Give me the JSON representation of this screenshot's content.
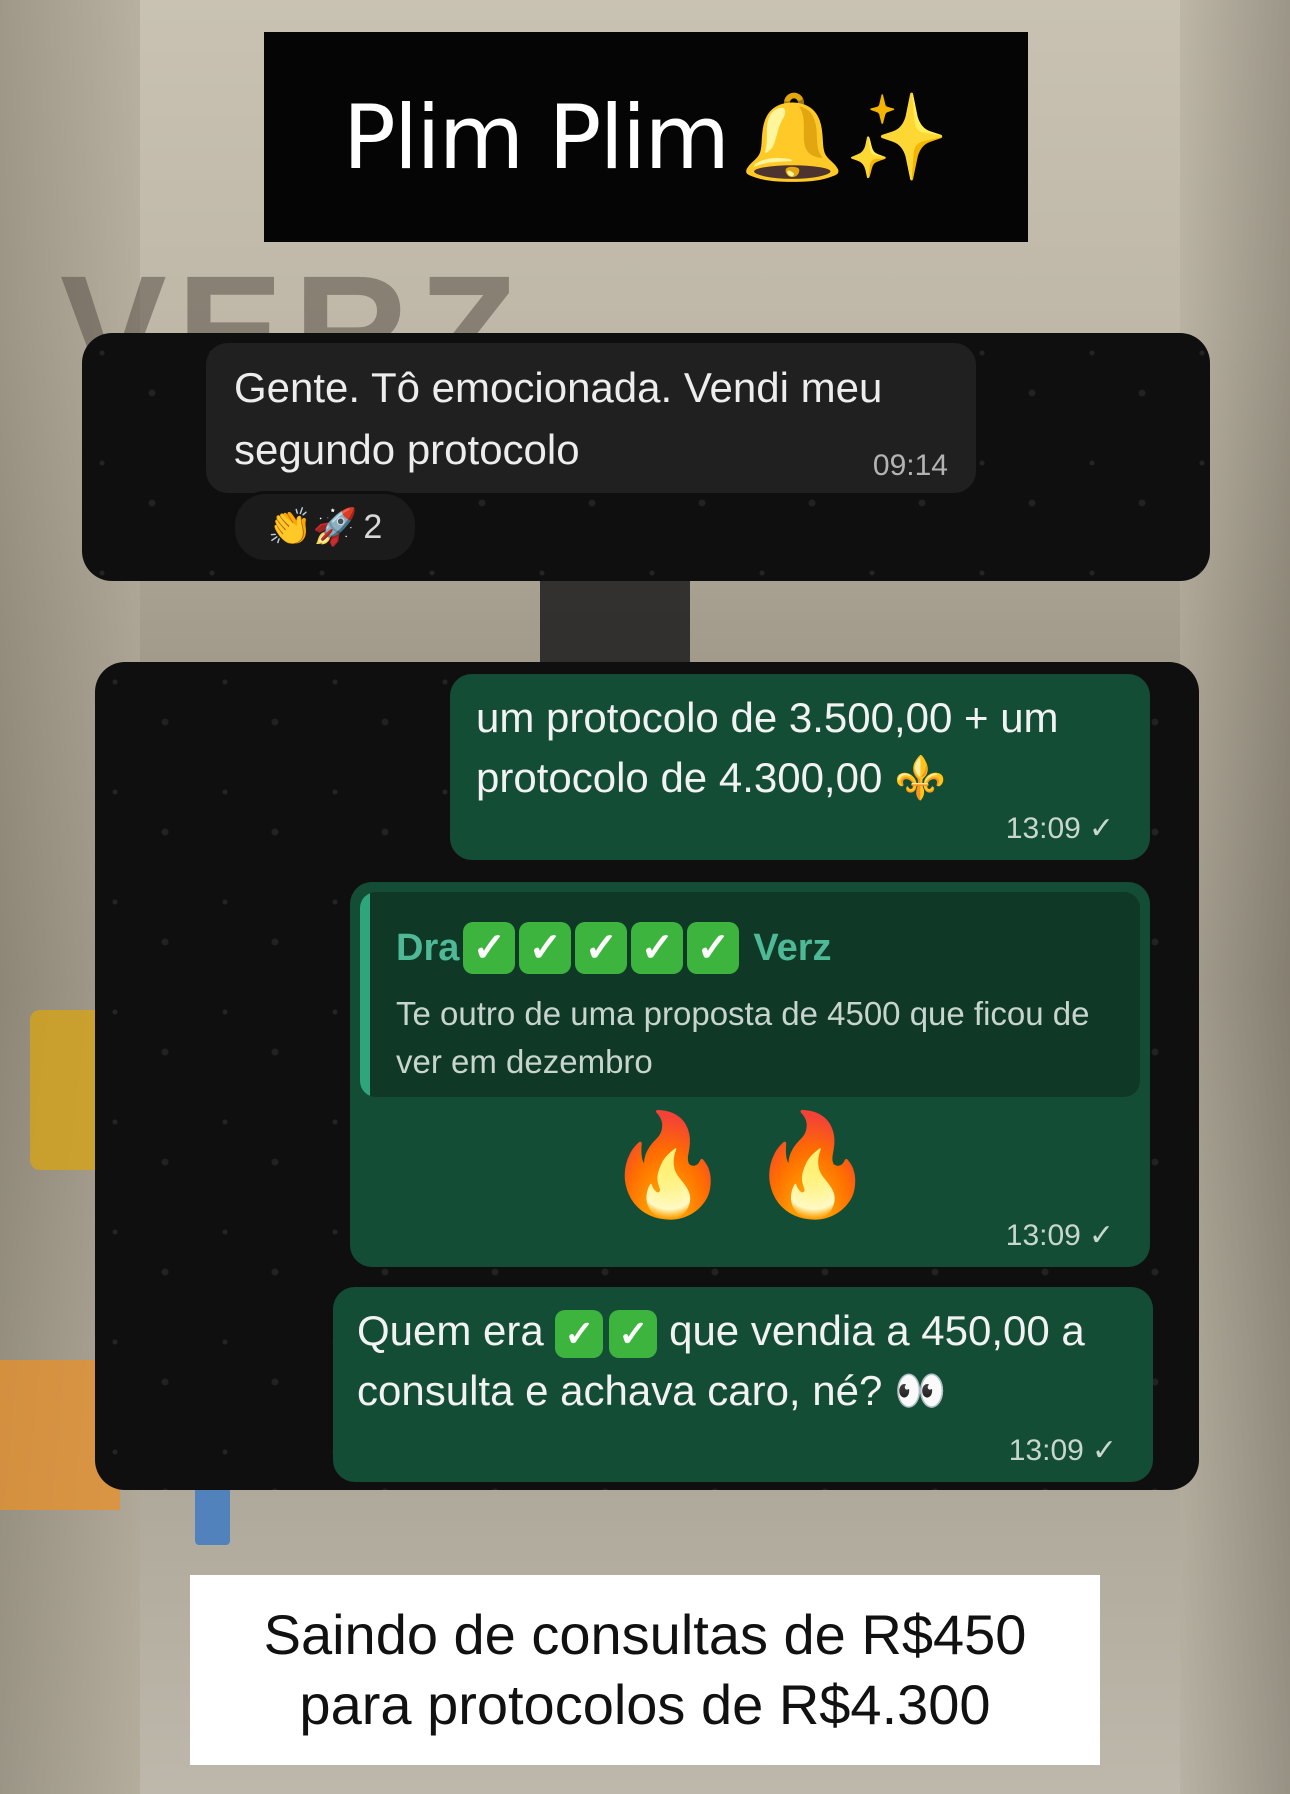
{
  "title": {
    "text": "Plim Plim",
    "emoji": "🔔✨"
  },
  "chat1": {
    "message": "Gente. Tô emocionada. Vendi meu segundo protocolo",
    "time": "09:14",
    "reactions": {
      "emojis": "👏🚀",
      "count": "2"
    }
  },
  "chat2": {
    "msg1": {
      "text": "um protocolo de 3.500,00 + um protocolo de 4.300,00 ⚜️",
      "time": "13:09",
      "status": "✓"
    },
    "msg2": {
      "quote_author_prefix": "Dra",
      "quote_author_suffix": "Verz",
      "quote_checks": [
        "✓",
        "✓",
        "✓",
        "✓",
        "✓"
      ],
      "quote_text": "Te outro de uma proposta de 4500 que ficou de ver em dezembro",
      "fire": "🔥🔥",
      "time": "13:09",
      "status": "✓"
    },
    "msg3": {
      "text_prefix": "Quem era",
      "text_suffix": "que vendia a 450,00 a consulta e achava caro, né? 👀",
      "checks": [
        "✓",
        "✓"
      ],
      "time": "13:09",
      "status": "✓"
    }
  },
  "caption": {
    "line1": "Saindo de consultas de R$450",
    "line2": "para protocolos de R$4.300"
  },
  "colors": {
    "bubble_out": "#144d35",
    "bubble_in": "#202021",
    "accent": "#4fb896"
  }
}
